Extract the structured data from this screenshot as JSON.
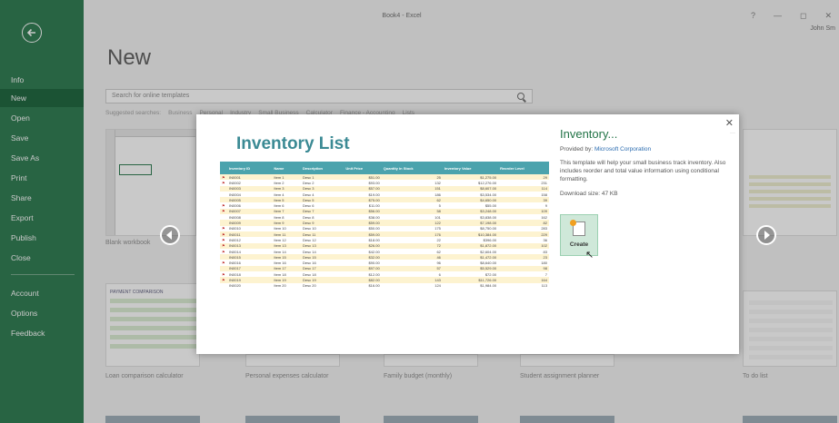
{
  "app": {
    "window_title": "Book4 - Excel",
    "help": "?",
    "minimize": "—",
    "restore": "◻",
    "close": "✕",
    "user": "John Sm"
  },
  "sidebar": {
    "items": [
      {
        "label": "Info"
      },
      {
        "label": "New"
      },
      {
        "label": "Open"
      },
      {
        "label": "Save"
      },
      {
        "label": "Save As"
      },
      {
        "label": "Print"
      },
      {
        "label": "Share"
      },
      {
        "label": "Export"
      },
      {
        "label": "Publish"
      },
      {
        "label": "Close"
      },
      {
        "label": "Account"
      },
      {
        "label": "Options"
      },
      {
        "label": "Feedback"
      }
    ],
    "active": "New"
  },
  "main": {
    "title": "New",
    "search_placeholder": "Search for online templates",
    "suggested_label": "Suggested searches:",
    "suggested": [
      "Business",
      "Personal",
      "Industry",
      "Small Business",
      "Calculator",
      "Finance - Accounting",
      "Lists"
    ],
    "blank_label": "Blank workbook",
    "templates": [
      {
        "label": "Loan comparison calculator"
      },
      {
        "label": "Personal expenses calculator"
      },
      {
        "label": "Family budget (monthly)"
      },
      {
        "label": "Student assignment planner"
      },
      {
        "label": "To do list"
      }
    ],
    "loan_header": "PAYMENT COMPARISON"
  },
  "modal": {
    "close_glyph": "✕",
    "preview_title": "Inventory List",
    "columns": [
      "Inventory ID",
      "Name",
      "Description",
      "Unit Price",
      "Quantity in Stock",
      "Inventory Value",
      "Reorder Level"
    ],
    "rows": [
      [
        "IN0001",
        "Item 1",
        "Desc 1",
        "$51.00",
        "25",
        "$1,275.00",
        "29"
      ],
      [
        "IN0002",
        "Item 2",
        "Desc 2",
        "$93.00",
        "132",
        "$12,276.00",
        "231"
      ],
      [
        "IN0003",
        "Item 3",
        "Desc 3",
        "$57.00",
        "151",
        "$8,607.00",
        "114"
      ],
      [
        "IN0004",
        "Item 4",
        "Desc 4",
        "$19.00",
        "186",
        "$3,534.00",
        "158"
      ],
      [
        "IN0005",
        "Item 5",
        "Desc 5",
        "$75.00",
        "62",
        "$4,650.00",
        "39"
      ],
      [
        "IN0006",
        "Item 6",
        "Desc 6",
        "$11.00",
        "5",
        "$55.00",
        "9"
      ],
      [
        "IN0007",
        "Item 7",
        "Desc 7",
        "$56.00",
        "58",
        "$3,248.00",
        "109"
      ],
      [
        "IN0008",
        "Item 8",
        "Desc 8",
        "$38.00",
        "101",
        "$3,838.00",
        "162"
      ],
      [
        "IN0009",
        "Item 9",
        "Desc 9",
        "$59.00",
        "122",
        "$7,198.00",
        "82"
      ],
      [
        "IN0010",
        "Item 10",
        "Desc 10",
        "$50.00",
        "175",
        "$8,750.00",
        "283"
      ],
      [
        "IN0011",
        "Item 11",
        "Desc 11",
        "$59.00",
        "176",
        "$10,384.00",
        "229"
      ],
      [
        "IN0012",
        "Item 12",
        "Desc 12",
        "$18.00",
        "22",
        "$396.00",
        "36"
      ],
      [
        "IN0013",
        "Item 13",
        "Desc 13",
        "$26.00",
        "72",
        "$1,872.00",
        "102"
      ],
      [
        "IN0014",
        "Item 14",
        "Desc 14",
        "$42.00",
        "62",
        "$2,604.00",
        "83"
      ],
      [
        "IN0015",
        "Item 15",
        "Desc 15",
        "$32.00",
        "46",
        "$1,472.00",
        "23"
      ],
      [
        "IN0016",
        "Item 16",
        "Desc 16",
        "$90.00",
        "96",
        "$8,640.00",
        "180"
      ],
      [
        "IN0017",
        "Item 17",
        "Desc 17",
        "$97.00",
        "57",
        "$5,529.00",
        "98"
      ],
      [
        "IN0018",
        "Item 18",
        "Desc 18",
        "$12.00",
        "6",
        "$72.00",
        "7"
      ],
      [
        "IN0019",
        "Item 19",
        "Desc 19",
        "$82.00",
        "143",
        "$11,726.00",
        "164"
      ],
      [
        "IN0020",
        "Item 20",
        "Desc 20",
        "$16.00",
        "124",
        "$1,984.00",
        "113"
      ]
    ],
    "flagged_rows": [
      0,
      1,
      5,
      6,
      9,
      10,
      11,
      12,
      13,
      15,
      17,
      18
    ],
    "info_title": "Inventory...",
    "provided_by_label": "Provided by:",
    "provider": "Microsoft Corporation",
    "description": "This template will help your small business track inventory. Also includes reorder and total value information using conditional formatting.",
    "download_label": "Download size:",
    "download_size": "47 KB",
    "create_label": "Create"
  },
  "colors": {
    "accent": "#217346",
    "sidebar_active": "#0e5c31",
    "table_header": "#4ba3ad",
    "row_highlight": "#fdf3d0"
  }
}
